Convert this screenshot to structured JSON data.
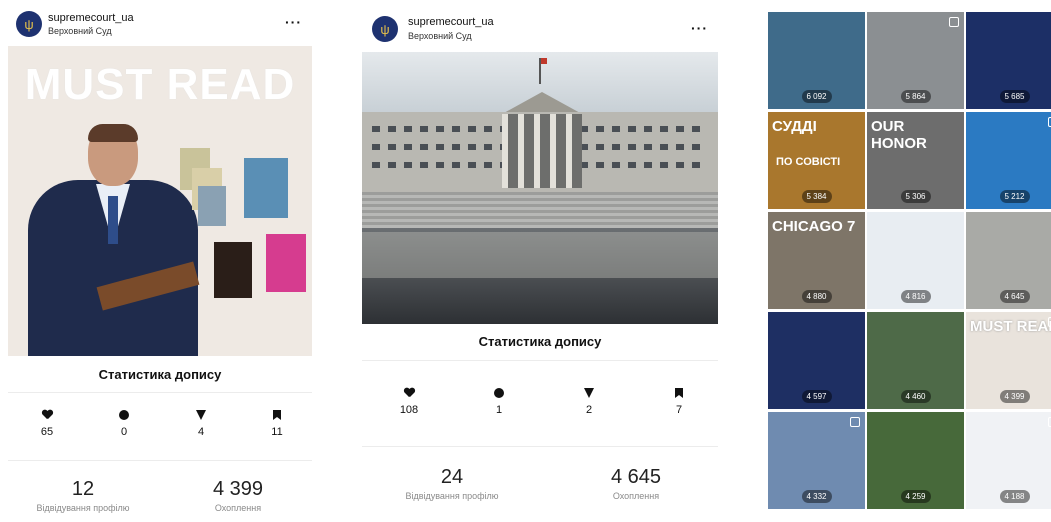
{
  "posts": [
    {
      "username": "supremecourt_ua",
      "subtitle": "Верховний Суд",
      "more": "···",
      "image_text": "MUST READ",
      "stats_title": "Статистика допису",
      "metrics": {
        "likes": "65",
        "comments": "0",
        "shares": "4",
        "saves": "11"
      },
      "profile_visits": "12",
      "profile_visits_label": "Відвідування профілю",
      "reach": "4 399",
      "reach_label": "Охоплення"
    },
    {
      "username": "supremecourt_ua",
      "subtitle": "Верховний Суд",
      "more": "···",
      "stats_title": "Статистика допису",
      "metrics": {
        "likes": "108",
        "comments": "1",
        "shares": "2",
        "saves": "7"
      },
      "profile_visits": "24",
      "profile_visits_label": "Відвідування профілю",
      "reach": "4 645",
      "reach_label": "Охоплення"
    }
  ],
  "grid": [
    {
      "count": "6 092",
      "bg": "#3f6b8a"
    },
    {
      "count": "5 864",
      "bg": "#8b8f92"
    },
    {
      "count": "5 685",
      "bg": "#1c2f66"
    },
    {
      "count": "5 384",
      "bg": "#a9772d",
      "text": "СУДДІ",
      "text2": "ПО СОВІСТІ"
    },
    {
      "count": "5 306",
      "bg": "#6d6d6d",
      "text": "OUR HONOR"
    },
    {
      "count": "5 212",
      "bg": "#2b7ac2"
    },
    {
      "count": "4 880",
      "bg": "#7e7568",
      "text": "CHICAGO 7"
    },
    {
      "count": "4 816",
      "bg": "#e8edf2"
    },
    {
      "count": "4 645",
      "bg": "#a9aaa6"
    },
    {
      "count": "4 597",
      "bg": "#1e2f63"
    },
    {
      "count": "4 460",
      "bg": "#4e6a48"
    },
    {
      "count": "4 399",
      "bg": "#e9e3dc",
      "text": "MUST READ"
    },
    {
      "count": "4 332",
      "bg": "#6f8bb0"
    },
    {
      "count": "4 259",
      "bg": "#47693a"
    },
    {
      "count": "4 188",
      "bg": "#f0f2f5"
    }
  ]
}
